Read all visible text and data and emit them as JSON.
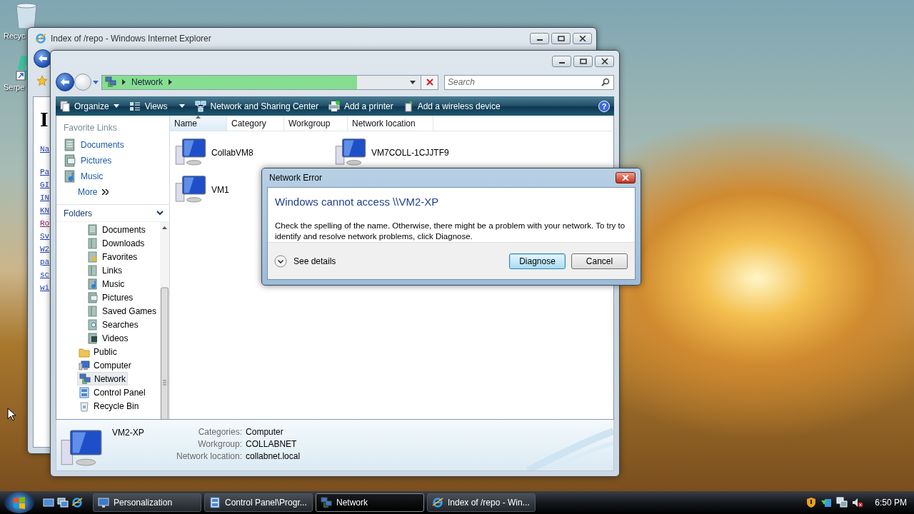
{
  "desktop_icons": [
    {
      "label": "Recyc"
    },
    {
      "label": "Serpe"
    }
  ],
  "ie_window": {
    "title": "Index of /repo - Windows Internet Explorer",
    "page_heading": "I",
    "page_links": [
      "Na",
      "Pa",
      "GI",
      "IN",
      "KN",
      "Ro",
      "Sv",
      "W2",
      "pa",
      "sc",
      "wi"
    ]
  },
  "explorer": {
    "address": {
      "crumbs": [
        "Network"
      ],
      "level": 0.8
    },
    "search": {
      "placeholder": "Search"
    },
    "help": "?",
    "toolbar": [
      {
        "label": "Organize",
        "kind": "menu"
      },
      {
        "label": "Views",
        "kind": "split"
      },
      {
        "label": "Network and Sharing Center",
        "kind": "network"
      },
      {
        "label": "Add a printer",
        "kind": "printer"
      },
      {
        "label": "Add a wireless device",
        "kind": "wireless"
      }
    ],
    "favorite_links": {
      "title": "Favorite Links",
      "items": [
        {
          "label": "Documents",
          "kind": "documents"
        },
        {
          "label": "Pictures",
          "kind": "pictures"
        },
        {
          "label": "Music",
          "kind": "music"
        }
      ],
      "more": "More"
    },
    "folders": {
      "title": "Folders",
      "items": [
        {
          "children": [
            {
              "label": "Documents",
              "kind": "documents",
              "selected": false
            },
            {
              "label": "Downloads",
              "kind": "library",
              "selected": false
            },
            {
              "label": "Favorites",
              "kind": "favorites",
              "selected": false
            },
            {
              "label": "Links",
              "kind": "library",
              "selected": false
            },
            {
              "label": "Music",
              "kind": "music",
              "selected": false
            },
            {
              "label": "Pictures",
              "kind": "pictures",
              "selected": false
            },
            {
              "label": "Saved Games",
              "kind": "library",
              "selected": false
            },
            {
              "label": "Searches",
              "kind": "searches",
              "selected": false
            },
            {
              "label": "Videos",
              "kind": "videos",
              "selected": false
            }
          ]
        },
        {
          "label": "Public",
          "kind": "folder",
          "selected": false
        },
        {
          "label": "Computer",
          "kind": "computer",
          "selected": false
        },
        {
          "label": "Network",
          "kind": "network",
          "selected": true
        },
        {
          "label": "Control Panel",
          "kind": "control",
          "selected": false
        },
        {
          "label": "Recycle Bin",
          "kind": "bin",
          "selected": false
        }
      ]
    },
    "columns": [
      {
        "label": "Name",
        "sorted": true
      },
      {
        "label": "Category",
        "sorted": false
      },
      {
        "label": "Workgroup",
        "sorted": false
      },
      {
        "label": "Network location",
        "sorted": false
      }
    ],
    "items": [
      {
        "label": "CollabVM8"
      },
      {
        "label": "VM7COLL-1CJJTF9"
      },
      {
        "label": "VM1"
      }
    ],
    "details": {
      "name": "VM2-XP",
      "fields": [
        {
          "label": "Categories:",
          "value": "Computer"
        },
        {
          "label": "Workgroup:",
          "value": "COLLABNET"
        },
        {
          "label": "Network location:",
          "value": "collabnet.local"
        }
      ]
    }
  },
  "dialog": {
    "title": "Network Error",
    "heading": "Windows cannot access \\\\VM2-XP",
    "message": "Check the spelling of the name. Otherwise, there might be a problem with your network. To try to identify and resolve network problems, click Diagnose.",
    "details_toggle": "See details",
    "buttons": [
      {
        "label": "Diagnose",
        "default": true
      },
      {
        "label": "Cancel",
        "default": false
      }
    ]
  },
  "taskbar": {
    "buttons": [
      {
        "label": "Personalization",
        "kind": "display",
        "selected": false
      },
      {
        "label": "Control Panel\\Progr...",
        "kind": "control",
        "selected": false
      },
      {
        "label": "Network",
        "kind": "network",
        "selected": true
      },
      {
        "label": "Index of /repo - Win...",
        "kind": "browser",
        "selected": false
      }
    ],
    "clock": "6:50 PM"
  }
}
